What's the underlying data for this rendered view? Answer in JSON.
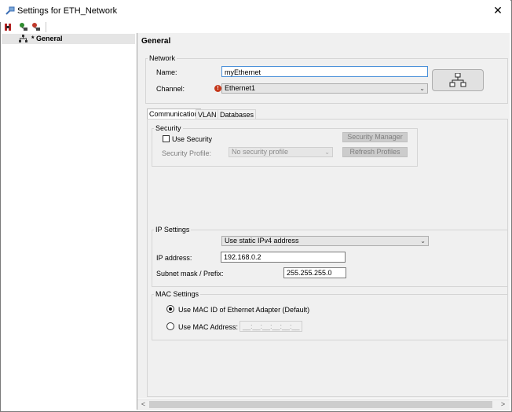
{
  "window": {
    "title": "Settings for ETH_Network",
    "close_glyph": "✕",
    "title_icon": "network-plug-icon"
  },
  "toolbar": {
    "buttons": [
      "export-icon",
      "add-node-icon",
      "remove-node-icon"
    ]
  },
  "tree": {
    "items": [
      {
        "label": "* General",
        "icon": "network-node-icon",
        "selected": true
      }
    ]
  },
  "page": {
    "title": "General"
  },
  "network": {
    "group_label": "Network",
    "name_label": "Name:",
    "name_value": "myEthernet",
    "channel_label": "Channel:",
    "channel_value": "Ethernet1",
    "channel_status_glyph": "!",
    "network_button_icon": "network-topology-icon"
  },
  "tabs": [
    {
      "label": "Communication",
      "active": true
    },
    {
      "label": "VLAN",
      "active": false
    },
    {
      "label": "Databases",
      "active": false
    }
  ],
  "security": {
    "group_label": "Security",
    "use_security_label": "Use Security",
    "use_security_checked": false,
    "profile_label": "Security Profile:",
    "profile_value": "No security profile",
    "manager_button": "Security Manager",
    "refresh_button": "Refresh Profiles"
  },
  "ip": {
    "group_label": "IP Settings",
    "mode_value": "Use static IPv4 address",
    "address_label": "IP address:",
    "address_value": "192.168.0.2",
    "mask_label": "Subnet mask / Prefix:",
    "mask_value": "255.255.255.0"
  },
  "mac": {
    "group_label": "MAC Settings",
    "option_default": "Use MAC ID of Ethernet Adapter (Default)",
    "option_custom": "Use MAC Address:",
    "custom_placeholder": "__:__:__:__:__:__",
    "selected": "default"
  },
  "scrollbar": {
    "left_glyph": "<",
    "right_glyph": ">"
  }
}
